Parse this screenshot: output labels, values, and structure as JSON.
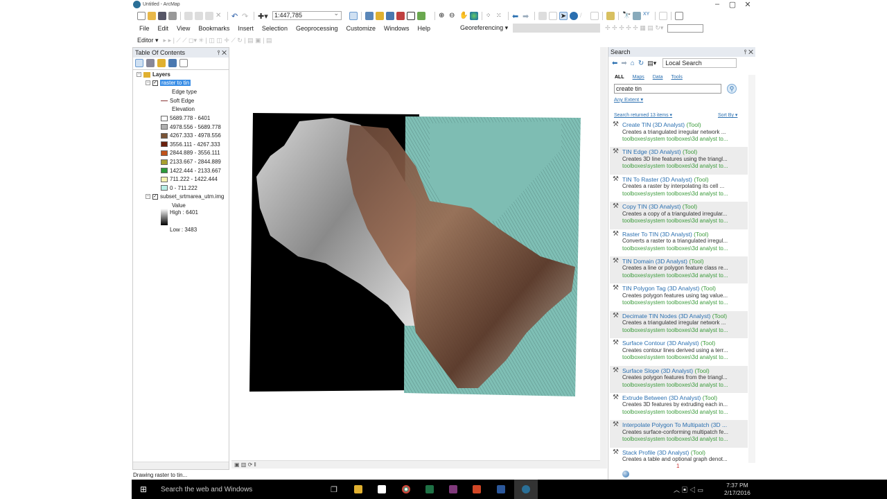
{
  "window": {
    "title": "Untitled - ArcMap"
  },
  "toolbar": {
    "scale": "1:447,785",
    "georef_label": "Georeferencing",
    "editor_label": "Editor"
  },
  "menu": [
    "File",
    "Edit",
    "View",
    "Bookmarks",
    "Insert",
    "Selection",
    "Geoprocessing",
    "Customize",
    "Windows",
    "Help"
  ],
  "toc": {
    "title": "Table Of Contents",
    "root": "Layers",
    "layer1": {
      "name": "raster to tin",
      "edge_heading": "Edge type",
      "edge_item": "Soft Edge",
      "elev_heading": "Elevation",
      "classes": [
        {
          "label": "5689.778 - 6401",
          "color": "#ffffff"
        },
        {
          "label": "4978.556 - 5689.778",
          "color": "#b0b0b0"
        },
        {
          "label": "4267.333 - 4978.556",
          "color": "#7a5436"
        },
        {
          "label": "3556.111 - 4267.333",
          "color": "#6b1f0c"
        },
        {
          "label": "2844.889 - 3556.111",
          "color": "#c0521a"
        },
        {
          "label": "2133.667 - 2844.889",
          "color": "#a9a030"
        },
        {
          "label": "1422.444 - 2133.667",
          "color": "#2a9a3a"
        },
        {
          "label": "711.222 - 1422.444",
          "color": "#f5f3b0"
        },
        {
          "label": "0 - 711.222",
          "color": "#b8eee6"
        }
      ]
    },
    "layer2": {
      "name": "subset_srtmarea_utm.img",
      "value_heading": "Value",
      "high": "High : 6401",
      "low": "Low : 3483"
    }
  },
  "search": {
    "title": "Search",
    "scope": "Local Search",
    "tabs": [
      "ALL",
      "Maps",
      "Data",
      "Tools"
    ],
    "query": "create tin",
    "extent": "Any Extent",
    "summary": "Search returned 13 items",
    "sort": "Sort By",
    "results": [
      {
        "title": "Create TIN",
        "suffix": " (3D Analyst)",
        "type": "(Tool)",
        "desc": "Creates a triangulated irregular network ...",
        "path": "toolboxes\\system toolboxes\\3d analyst to..."
      },
      {
        "title": "TIN Edge",
        "suffix": " (3D Analyst)",
        "type": "(Tool)",
        "desc": "Creates 3D line features using the triangl...",
        "path": "toolboxes\\system toolboxes\\3d analyst to..."
      },
      {
        "title": "TIN To Raster",
        "suffix": " (3D Analyst)",
        "type": "(Tool)",
        "desc": "Creates a raster by interpolating its cell ...",
        "path": "toolboxes\\system toolboxes\\3d analyst to..."
      },
      {
        "title": "Copy TIN",
        "suffix": " (3D Analyst)",
        "type": "(Tool)",
        "desc": "Creates a copy of a triangulated irregular...",
        "path": "toolboxes\\system toolboxes\\3d analyst to..."
      },
      {
        "title": "Raster To TIN",
        "suffix": " (3D Analyst)",
        "type": "(Tool)",
        "desc": "Converts a raster to a triangulated irregul...",
        "path": "toolboxes\\system toolboxes\\3d analyst to..."
      },
      {
        "title": "TIN Domain",
        "suffix": " (3D Analyst)",
        "type": "(Tool)",
        "desc": "Creates a line or polygon feature class re...",
        "path": "toolboxes\\system toolboxes\\3d analyst to..."
      },
      {
        "title": "TIN Polygon Tag",
        "suffix": " (3D Analyst)",
        "type": "(Tool)",
        "desc": "Creates polygon features using tag value...",
        "path": "toolboxes\\system toolboxes\\3d analyst to..."
      },
      {
        "title": "Decimate TIN Nodes",
        "suffix": " (3D Analyst)",
        "type": "(Tool)",
        "desc": "Creates a triangulated irregular network ...",
        "path": "toolboxes\\system toolboxes\\3d analyst to..."
      },
      {
        "title": "Surface Contour",
        "suffix": " (3D Analyst)",
        "type": "(Tool)",
        "desc": "Creates contour lines derived using a terr...",
        "path": "toolboxes\\system toolboxes\\3d analyst to..."
      },
      {
        "title": "Surface Slope",
        "suffix": " (3D Analyst)",
        "type": "(Tool)",
        "desc": "Creates polygon features from the triangl...",
        "path": "toolboxes\\system toolboxes\\3d analyst to..."
      },
      {
        "title": "Extrude Between",
        "suffix": " (3D Analyst)",
        "type": "(Tool)",
        "desc": "Creates 3D features by extruding each in...",
        "path": "toolboxes\\system toolboxes\\3d analyst to..."
      },
      {
        "title": "Interpolate Polygon To Multipatch",
        "suffix": " (3D ...",
        "type": "",
        "desc": "Creates surface-conforming multipatch fe...",
        "path": "toolboxes\\system toolboxes\\3d analyst to..."
      },
      {
        "title": "Stack Profile",
        "suffix": " (3D Analyst)",
        "type": "(Tool)",
        "desc": "Creates a table and optional graph denot...",
        "path": ""
      }
    ],
    "page": "1"
  },
  "status": "Drawing raster to tin...",
  "taskbar": {
    "search_placeholder": "Search the web and Windows",
    "time": "7:37 PM",
    "date": "2/17/2016"
  }
}
